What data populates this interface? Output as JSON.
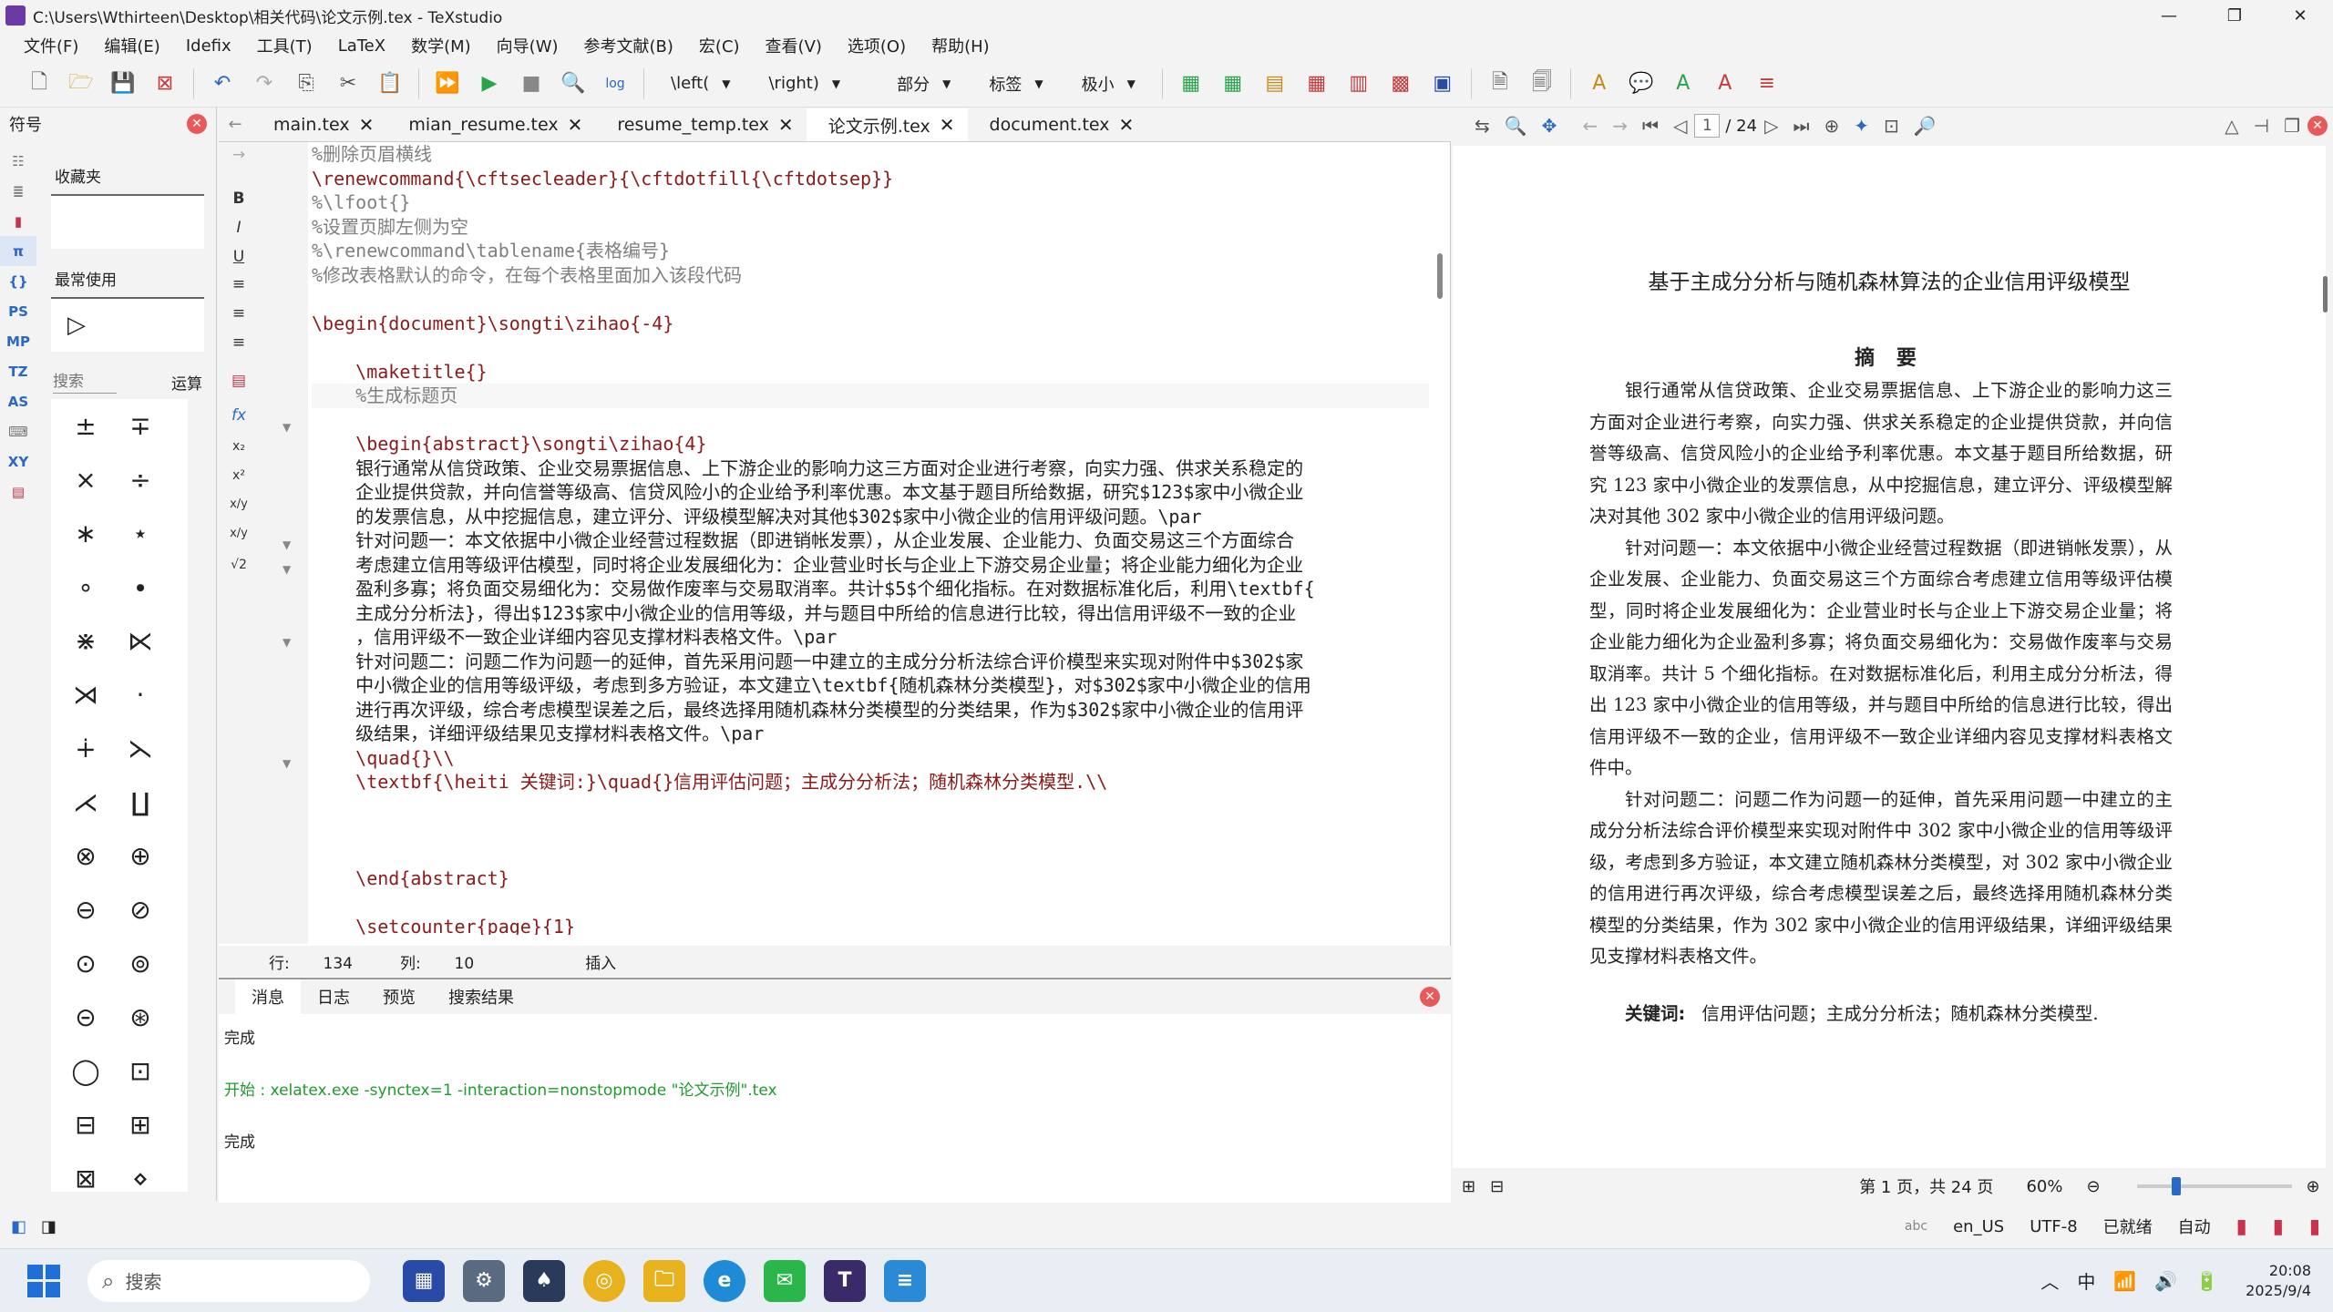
{
  "window": {
    "title": "C:\\Users\\Wthirteen\\Desktop\\相关代码\\论文示例.tex - TeXstudio"
  },
  "menu": [
    "文件(F)",
    "编辑(E)",
    "Idefix",
    "工具(T)",
    "LaTeX",
    "数学(M)",
    "向导(W)",
    "参考文献(B)",
    "宏(C)",
    "查看(V)",
    "选项(O)",
    "帮助(H)"
  ],
  "toolbar": {
    "left_combo": "\\left(",
    "right_combo": "\\right)",
    "section_combo": "部分",
    "label_combo": "标签",
    "size_combo": "极小"
  },
  "symbols": {
    "header": "符号",
    "favorites_label": "收藏夹",
    "recent_label": "最常使用",
    "search_placeholder": "搜索",
    "operators_label": "运算",
    "side_tabs": [
      "PS",
      "MP",
      "TZ",
      "AS",
      "XY"
    ],
    "grid": [
      "±",
      "∓",
      "×",
      "÷",
      "∗",
      "⋆",
      "∘",
      "∙",
      "⋇",
      "⋉",
      "⋊",
      "⋅",
      "∔",
      "⋋",
      "⋌",
      "∐",
      "⊗",
      "⊕",
      "⊖",
      "⊘",
      "⊙",
      "⊚",
      "⊝",
      "⊛",
      "◯",
      "⊡",
      "⊟",
      "⊞",
      "⊠",
      "⋄"
    ],
    "recent_symbol": "▷"
  },
  "tabs": [
    "main.tex",
    "mian_resume.tex",
    "resume_temp.tex",
    "论文示例.tex",
    "document.tex"
  ],
  "editor": {
    "lines": [
      "%删除页眉横线",
      "\\renewcommand{\\cftsecleader}{\\cftdotfill{\\cftdotsep}}",
      "%\\lfoot{}",
      "%设置页脚左侧为空",
      "%\\renewcommand\\tablename{表格编号}",
      "%修改表格默认的命令，在每个表格里面加入该段代码",
      "",
      "\\begin{document}\\songti\\zihao{-4}",
      "",
      "    \\maketitle{}",
      "    %生成标题页",
      "",
      "    \\begin{abstract}\\songti\\zihao{4}",
      "    银行通常从信贷政策、企业交易票据信息、上下游企业的影响力这三方面对企业进行考察，向实力强、供求关系稳定的",
      "    企业提供贷款，并向信誉等级高、信贷风险小的企业给予利率优惠。本文基于题目所给数据，研究$123$家中小微企业",
      "    的发票信息，从中挖掘信息，建立评分、评级模型解决对其他$302$家中小微企业的信用评级问题。\\par",
      "    针对问题一：本文依据中小微企业经营过程数据（即进销帐发票），从企业发展、企业能力、负面交易这三个方面综合",
      "    考虑建立信用等级评估模型，同时将企业发展细化为：企业营业时长与企业上下游交易企业量；将企业能力细化为企业",
      "    盈利多寡；将负面交易细化为：交易做作废率与交易取消率。共计$5$个细化指标。在对数据标准化后，利用\\textbf{",
      "    主成分分析法}，得出$123$家中小微企业的信用等级，并与题目中所给的信息进行比较，得出信用评级不一致的企业",
      "    ，信用评级不一致企业详细内容见支撑材料表格文件。\\par",
      "    针对问题二：问题二作为问题一的延伸，首先采用问题一中建立的主成分分析法综合评价模型来实现对附件中$302$家",
      "    中小微企业的信用等级评级，考虑到多方验证，本文建立\\textbf{随机森林分类模型}，对$302$家中小微企业的信用",
      "    进行再次评级，综合考虑模型误差之后，最终选择用随机森林分类模型的分类结果，作为$302$家中小微企业的信用评",
      "    级结果，详细评级结果见支撑材料表格文件。\\par",
      "    \\quad{}\\\\",
      "    \\textbf{\\heiti 关键词:}\\quad{}信用评估问题；主成分分析法；随机森林分类模型.\\\\",
      "",
      "",
      "",
      "    \\end{abstract}",
      "",
      "    \\setcounter{page}{1}"
    ],
    "status": {
      "line_label": "行:",
      "line": "134",
      "col_label": "列:",
      "col": "10",
      "mode": "插入"
    }
  },
  "messages": {
    "tabs": [
      "消息",
      "日志",
      "预览",
      "搜索结果"
    ],
    "lines": [
      "完成",
      "开始 : xelatex.exe -synctex=1 -interaction=nonstopmode \"论文示例\".tex",
      "完成"
    ]
  },
  "pdf": {
    "page_input": "1",
    "page_total": "/ 24",
    "title": "基于主成分分析与随机森林算法的企业信用评级模型",
    "abstract_heading": "摘 要",
    "paragraphs": [
      "银行通常从信贷政策、企业交易票据信息、上下游企业的影响力这三方面对企业进行考察，向实力强、供求关系稳定的企业提供贷款，并向信誉等级高、信贷风险小的企业给予利率优惠。本文基于题目所给数据，研究 123 家中小微企业的发票信息，从中挖掘信息，建立评分、评级模型解决对其他 302 家中小微企业的信用评级问题。",
      "针对问题一：本文依据中小微企业经营过程数据（即进销帐发票），从企业发展、企业能力、负面交易这三个方面综合考虑建立信用等级评估模型，同时将企业发展细化为：企业营业时长与企业上下游交易企业量；将企业能力细化为企业盈利多寡；将负面交易细化为：交易做作废率与交易取消率。共计 5 个细化指标。在对数据标准化后，利用主成分分析法，得出 123 家中小微企业的信用等级，并与题目中所给的信息进行比较，得出信用评级不一致的企业，信用评级不一致企业详细内容见支撑材料表格文件中。",
      "针对问题二：问题二作为问题一的延伸，首先采用问题一中建立的主成分分析法综合评价模型来实现对附件中 302 家中小微企业的信用等级评级，考虑到多方验证，本文建立随机森林分类模型，对 302 家中小微企业的信用进行再次评级，综合考虑模型误差之后，最终选择用随机森林分类模型的分类结果，作为 302 家中小微企业的信用评级结果，详细评级结果见支撑材料表格文件。"
    ],
    "keywords_label": "关键词:",
    "keywords": "信用评估问题；主成分分析法；随机森林分类模型.",
    "page_info": "第 1 页，共 24 页",
    "zoom": "60%"
  },
  "statusbar": {
    "lang": "en_US",
    "encoding": "UTF-8",
    "ready": "已就绪",
    "auto": "自动"
  },
  "taskbar": {
    "search": "搜索",
    "ime": "中",
    "time": "20:08",
    "date": "2025/9/4"
  }
}
